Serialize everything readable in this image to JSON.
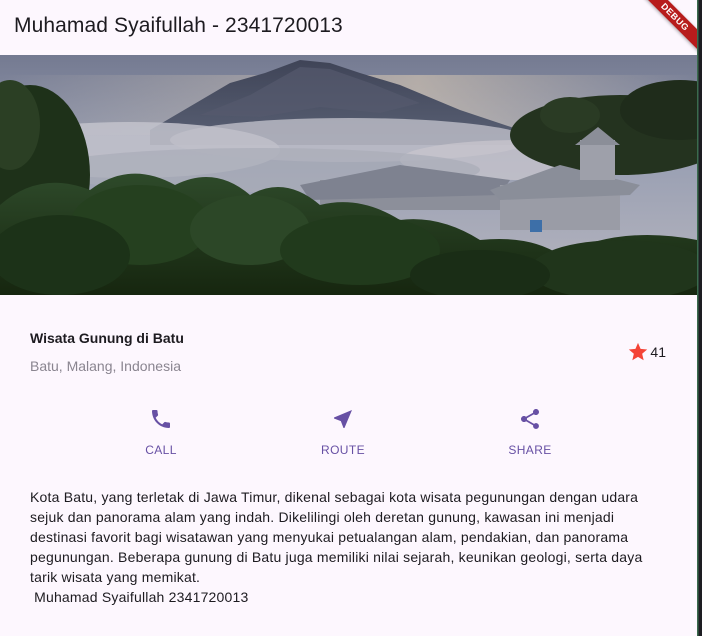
{
  "appbar": {
    "title": "Muhamad Syaifullah - 2341720013",
    "debug_banner": "DEBUG"
  },
  "hero": {
    "image_icon": "mountain-landscape-photo"
  },
  "place": {
    "name": "Wisata Gunung di Batu",
    "location": "Batu, Malang, Indonesia",
    "rating_count": "41",
    "star_color": "#f44336"
  },
  "actions": [
    {
      "label": "CALL",
      "icon": "phone-icon"
    },
    {
      "label": "ROUTE",
      "icon": "near-me-icon"
    },
    {
      "label": "SHARE",
      "icon": "share-icon"
    }
  ],
  "colors": {
    "primary": "#6750a4",
    "surface": "#fdf7fe",
    "text": "#1d1b20",
    "muted": "#8a8590"
  },
  "description": {
    "body": "Kota Batu, yang terletak di Jawa Timur, dikenal sebagai kota wisata pegunungan dengan udara sejuk dan panorama alam yang indah. Dikelilingi oleh deretan gunung, kawasan ini menjadi destinasi favorit bagi wisatawan yang menyukai petualangan alam, pendakian, dan panorama pegunungan. Beberapa gunung di Batu juga memiliki nilai sejarah, keunikan geologi, serta daya tarik wisata yang memikat.",
    "signature": " Muhamad Syaifullah 2341720013"
  }
}
